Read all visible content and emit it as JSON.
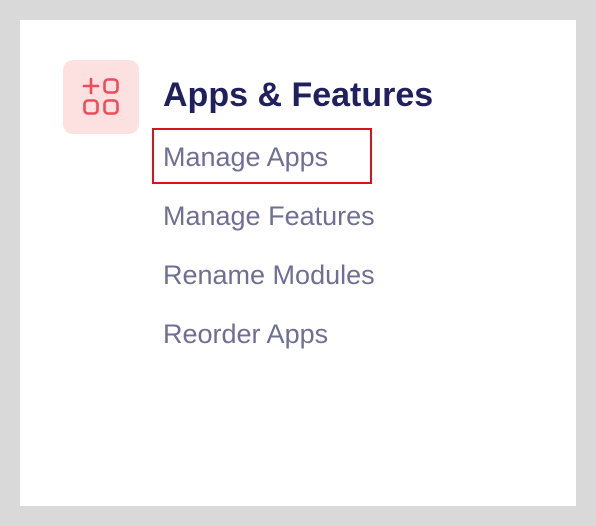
{
  "section": {
    "title": "Apps & Features",
    "icon": "apps-add-icon",
    "accent_color": "#ef4b5a",
    "tile_color": "#fde1e1"
  },
  "menu": {
    "items": [
      {
        "label": "Manage Apps",
        "highlighted": true
      },
      {
        "label": "Manage Features",
        "highlighted": false
      },
      {
        "label": "Rename Modules",
        "highlighted": false
      },
      {
        "label": "Reorder Apps",
        "highlighted": false
      }
    ]
  },
  "highlight_color": "#d9121b"
}
